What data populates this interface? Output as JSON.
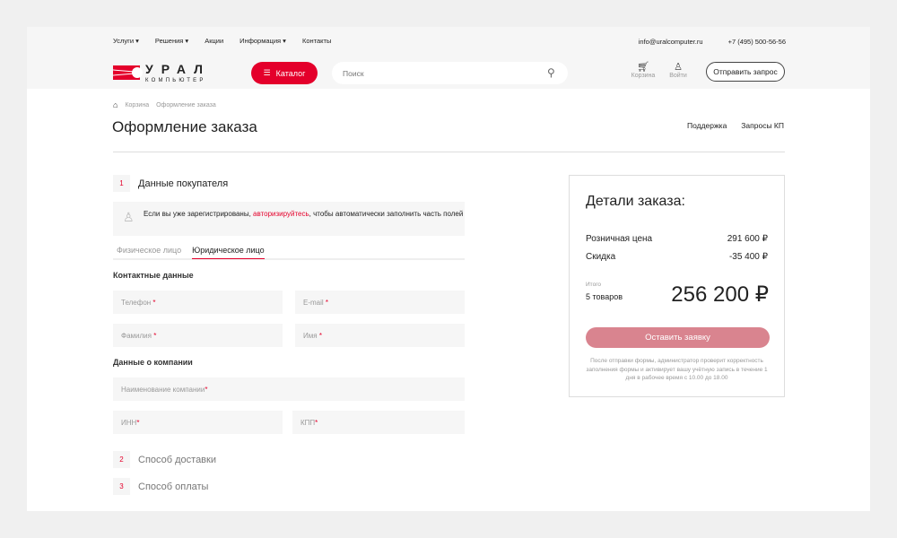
{
  "header": {
    "nav": [
      "Услуги ▾",
      "Решения ▾",
      "Акции",
      "Информация ▾",
      "Контакты"
    ],
    "email": "info@uralcomputer.ru",
    "phone": "+7 (495) 500-56-56",
    "logo_text": "УРАЛ КОМПЬЮТЕР",
    "catalog": "Каталог",
    "search_placeholder": "Поиск",
    "cart": "Корзина",
    "login": "Войти",
    "request": "Отправить запрос"
  },
  "breadcrumb": [
    "Корзина",
    "Оформление заказа"
  ],
  "title": "Оформление заказа",
  "links": [
    "Поддержка",
    "Запросы КП"
  ],
  "steps": [
    {
      "num": "1",
      "label": "Данные покупателя"
    },
    {
      "num": "2",
      "label": "Способ доставки"
    },
    {
      "num": "3",
      "label": "Способ оплаты"
    }
  ],
  "info": {
    "before": "Если вы уже зарегистрированы, ",
    "link": "авторизируйтесь",
    "after": ", чтобы автоматически заполнить часть полей"
  },
  "tabs": [
    "Физическое лицо",
    "Юридическое лицо"
  ],
  "contact_title": "Контактные данные",
  "company_title": "Данные о компании",
  "fields": {
    "phone": "Телефон",
    "email": "E-mail",
    "surname": "Фамилия",
    "name": "Имя",
    "company": "Наименование  компании",
    "inn": "ИНН",
    "kpp": "КПП",
    "star": "*"
  },
  "order": {
    "title": "Детали заказа:",
    "retail_label": "Розничная цена",
    "retail": "291 600 ₽",
    "discount_label": "Скидка",
    "discount": "-35 400 ₽",
    "total_label": "Итого",
    "count": "5 товаров",
    "total": "256 200 ₽",
    "submit": "Оставить заявку",
    "note": "После отправки формы, администратор проверит корректность заполнения формы и активирует вашу учётную запись в течение 1 дня в рабочее время с 10.00 до 18.00"
  },
  "colors": {
    "accent": "#e4002b",
    "button_disabled": "#d9848f"
  }
}
